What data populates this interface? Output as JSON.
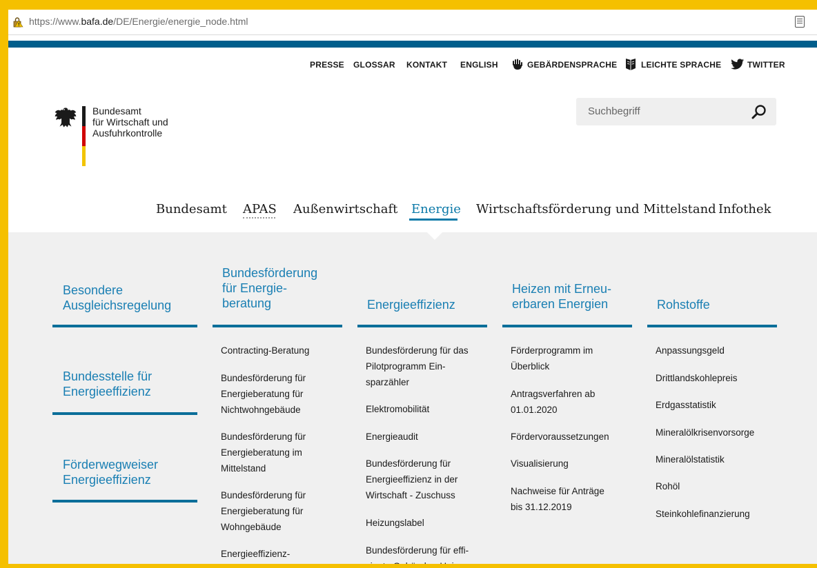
{
  "browser": {
    "url_host": "https://www.",
    "url_domain": "bafa.de",
    "url_path": "/DE/Energie/energie_node.html"
  },
  "service_nav": {
    "presse": "PRESSE",
    "glossar": "GLOSSAR",
    "kontakt": "KONTAKT",
    "english": "ENGLISH",
    "gebaerdensprache": "GEBÄRDENSPRACHE",
    "leichte_sprache": "LEICHTE SPRACHE",
    "twitter": "TWITTER"
  },
  "org": {
    "line1": "Bundesamt",
    "line2": "für Wirtschaft und",
    "line3": "Ausfuhrkontrolle"
  },
  "search": {
    "placeholder": "Suchbegriff"
  },
  "main_nav": {
    "bundesamt": "Bundesamt",
    "apas": "APAS",
    "aussenwirtschaft": "Außenwirtschaft",
    "energie": "Energie",
    "wirtschaftsfoerderung": "Wirtschaftsförderung und Mittelstand",
    "infothek": "Infothek"
  },
  "mega_menu": {
    "col1": {
      "headings": [
        [
          "Besondere",
          "Ausgleichsregelung"
        ],
        [
          "Bundesstelle für",
          "Energieeffizienz"
        ],
        [
          "Förderwegweiser",
          "Energieeffizienz"
        ]
      ]
    },
    "col2": {
      "heading": [
        "Bundesförderung",
        "für Energie-",
        "beratung"
      ],
      "links": [
        [
          "Contracting-Beratung"
        ],
        [
          "Bundesförderung für",
          "Energieberatung für",
          "Nichtwohngebäude"
        ],
        [
          "Bundesförderung für",
          "Energieberatung im",
          "Mittelstand"
        ],
        [
          "Bundesförderung für",
          "Energieberatung für",
          "Wohngebäude"
        ],
        [
          "Energieeffizienz-"
        ]
      ]
    },
    "col3": {
      "heading": [
        "Energieeffizienz"
      ],
      "links": [
        [
          "Bundesförderung für das",
          "Pilotprogramm Ein-",
          "sparzähler"
        ],
        [
          "Elektromobilität"
        ],
        [
          "Energieaudit"
        ],
        [
          "Bundesförderung für",
          "Energieeffizienz in der",
          "Wirtschaft - Zuschuss"
        ],
        [
          "Heizungslabel"
        ],
        [
          "Bundesförderung für effi-",
          "ziente Gebäude - Hei"
        ]
      ]
    },
    "col4": {
      "heading": [
        "Heizen mit Erneu-",
        "erbaren Energien"
      ],
      "links": [
        [
          "Förderprogramm im",
          "Überblick"
        ],
        [
          "Antragsverfahren ab",
          "01.01.2020"
        ],
        [
          "Fördervoraussetzungen"
        ],
        [
          "Visualisierung"
        ],
        [
          "Nachweise für Anträge",
          "bis 31.12.2019"
        ]
      ]
    },
    "col5": {
      "heading": [
        "Rohstoffe"
      ],
      "links": [
        [
          "Anpassungsgeld"
        ],
        [
          "Drittlandskohlepreis"
        ],
        [
          "Erdgasstatistik"
        ],
        [
          "Mineralölkrisenvorsorge"
        ],
        [
          "Mineralölstatistik"
        ],
        [
          "Rohöl"
        ],
        [
          "Steinkohlefinanzierung"
        ]
      ]
    }
  },
  "colors": {
    "frame": "#f5c000",
    "brand_blue": "#005e8c",
    "heading_blue": "#1a7fb3",
    "menu_bg": "#f0f0f0"
  }
}
